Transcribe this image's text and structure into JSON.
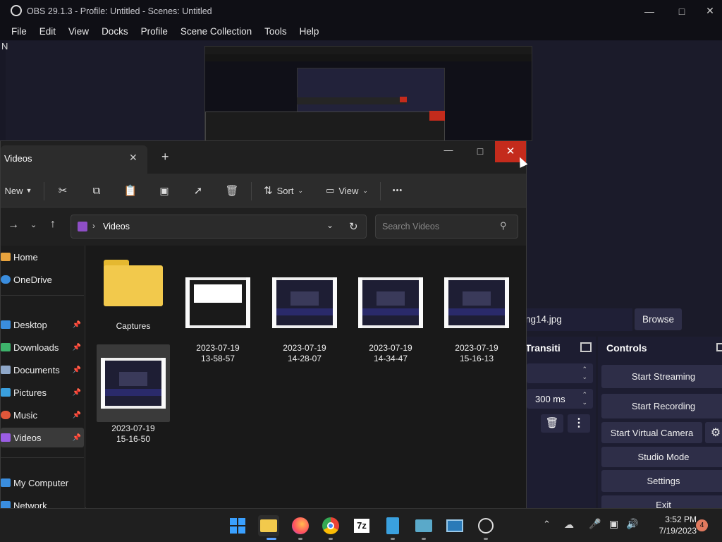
{
  "obs": {
    "title": "OBS 29.1.3 - Profile: Untitled - Scenes: Untitled",
    "menu": [
      "File",
      "Edit",
      "View",
      "Docks",
      "Profile",
      "Scene Collection",
      "Tools",
      "Help"
    ],
    "left_edge_char": "N",
    "image_path_partial": "ng14.jpg",
    "browse_label": "Browse",
    "transitions_label": "Transiti",
    "controls_label": "Controls",
    "duration": "300 ms",
    "controls": {
      "start_streaming": "Start Streaming",
      "start_recording": "Start Recording",
      "start_virtual_camera": "Start Virtual Camera",
      "studio_mode": "Studio Mode",
      "settings": "Settings",
      "exit": "Exit"
    }
  },
  "explorer": {
    "tab_title": "Videos",
    "toolbar": {
      "new": "New",
      "sort": "Sort",
      "view": "View",
      "more": "•••"
    },
    "breadcrumb": "Videos",
    "search_placeholder": "Search Videos",
    "sidebar": [
      {
        "label": "Home",
        "icon": "home-icon",
        "color": "#e8a33d"
      },
      {
        "label": "OneDrive",
        "icon": "cloud-icon",
        "color": "#3a8dde"
      },
      {
        "label": "Desktop",
        "icon": "desktop-icon",
        "color": "#3a8dde",
        "pinned": true
      },
      {
        "label": "Downloads",
        "icon": "download-icon",
        "color": "#3db36b",
        "pinned": true
      },
      {
        "label": "Documents",
        "icon": "document-icon",
        "color": "#8fa8c9",
        "pinned": true
      },
      {
        "label": "Pictures",
        "icon": "picture-icon",
        "color": "#3aa0de",
        "pinned": true
      },
      {
        "label": "Music",
        "icon": "music-icon",
        "color": "#e0573a",
        "pinned": true
      },
      {
        "label": "Videos",
        "icon": "video-icon",
        "color": "#9b5de5",
        "pinned": true,
        "selected": true
      },
      {
        "label": "My Computer",
        "icon": "computer-icon",
        "color": "#3a8dde"
      },
      {
        "label": "Network",
        "icon": "network-icon",
        "color": "#3a8dde"
      }
    ],
    "items": [
      {
        "type": "folder",
        "label": "Captures"
      },
      {
        "type": "video",
        "label": "2023-07-19\n13-58-57"
      },
      {
        "type": "video",
        "label": "2023-07-19\n14-28-07"
      },
      {
        "type": "video",
        "label": "2023-07-19\n14-34-47"
      },
      {
        "type": "video",
        "label": "2023-07-19\n15-16-13"
      },
      {
        "type": "video",
        "label": "2023-07-19\n15-16-50",
        "selected": true
      }
    ]
  },
  "taskbar": {
    "time": "3:52 PM",
    "date": "7/19/2023",
    "notification_count": "4",
    "apps": [
      "start-icon",
      "file-explorer-icon",
      "firefox-icon",
      "chrome-icon",
      "7zip-icon",
      "notepad-icon",
      "remote-desktop-icon",
      "image-viewer-icon",
      "obs-icon"
    ],
    "sevenzip_label": "7z"
  }
}
